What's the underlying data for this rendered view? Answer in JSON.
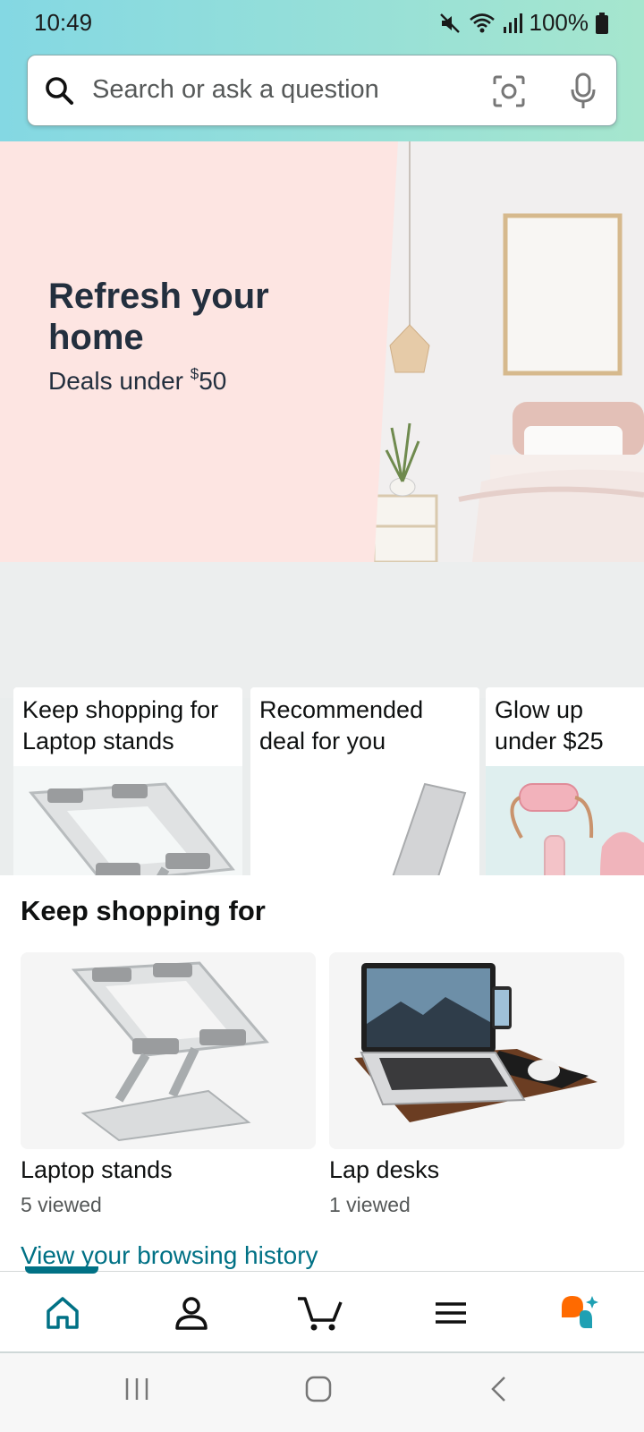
{
  "status_bar": {
    "time": "10:49",
    "battery": "100%"
  },
  "search": {
    "placeholder": "Search or ask a question"
  },
  "hero": {
    "title": "Refresh your home",
    "subtitle_prefix": "Deals under ",
    "currency": "$",
    "amount": "50"
  },
  "cards": [
    {
      "title_line1": "Keep shopping for",
      "title_line2": "Laptop stands"
    },
    {
      "title_line1": "Recommended",
      "title_line2": "deal for you"
    },
    {
      "title_line1": "Glow up",
      "title_line2": "under $25"
    }
  ],
  "keep_shopping": {
    "heading": "Keep shopping for",
    "items": [
      {
        "name": "Laptop stands",
        "count": "5 viewed"
      },
      {
        "name": "Lap desks",
        "count": "1 viewed"
      }
    ],
    "history_link": "View your browsing history"
  },
  "bottom_nav": {
    "items": [
      "home-icon",
      "account-icon",
      "cart-icon",
      "menu-icon",
      "assistant-icon"
    ],
    "active": "home-icon",
    "accent": "#007185"
  },
  "colors": {
    "header_gradient_start": "#84d8e3",
    "header_gradient_end": "#a6e6ce",
    "link": "#007185",
    "hero_pink": "#fde5e2"
  }
}
